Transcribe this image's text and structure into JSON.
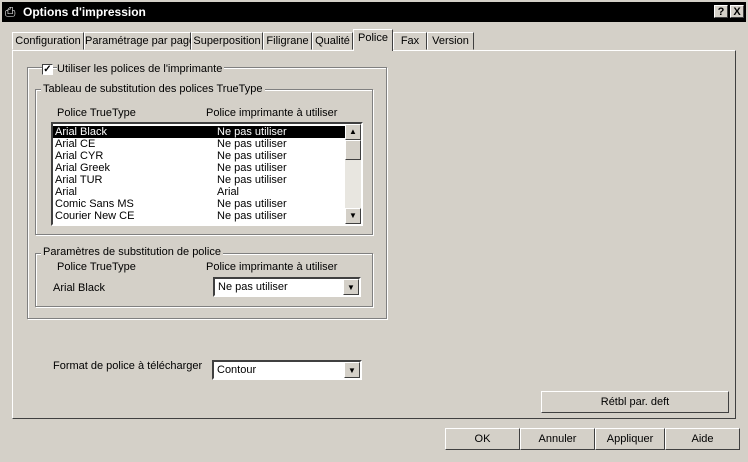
{
  "title": "Options d'impression",
  "title_icon": "printer-icon",
  "titlebar_buttons": {
    "help": "?",
    "close": "X"
  },
  "tabs": [
    "Configuration",
    "Paramétrage par page",
    "Superposition",
    "Filigrane",
    "Qualité",
    "Police",
    "Fax",
    "Version"
  ],
  "active_tab": "Police",
  "use_printer_fonts": {
    "label": "Utiliser les polices de l'imprimante",
    "checked": true
  },
  "table_group": {
    "label": "Tableau de substitution des polices TrueType",
    "col_truetype": "Police TrueType",
    "col_printer": "Police imprimante à utiliser",
    "rows": [
      {
        "font": "Arial Black",
        "printer": "Ne pas utiliser"
      },
      {
        "font": "Arial CE",
        "printer": "Ne pas utiliser"
      },
      {
        "font": "Arial CYR",
        "printer": "Ne pas utiliser"
      },
      {
        "font": "Arial Greek",
        "printer": "Ne pas utiliser"
      },
      {
        "font": "Arial TUR",
        "printer": "Ne pas utiliser"
      },
      {
        "font": "Arial",
        "printer": "Arial"
      },
      {
        "font": "Comic Sans MS",
        "printer": "Ne pas utiliser"
      },
      {
        "font": "Courier New CE",
        "printer": "Ne pas utiliser"
      }
    ]
  },
  "params_group": {
    "label": "Paramètres de substitution de police",
    "col_truetype": "Police TrueType",
    "col_printer": "Police imprimante à utiliser",
    "font": "Arial Black",
    "printer_value": "Ne pas utiliser"
  },
  "download_format": {
    "label": "Format de police à télécharger",
    "value": "Contour"
  },
  "reset_button": "Rétbl par. deft",
  "buttons": {
    "ok": "OK",
    "cancel": "Annuler",
    "apply": "Appliquer",
    "help": "Aide"
  }
}
